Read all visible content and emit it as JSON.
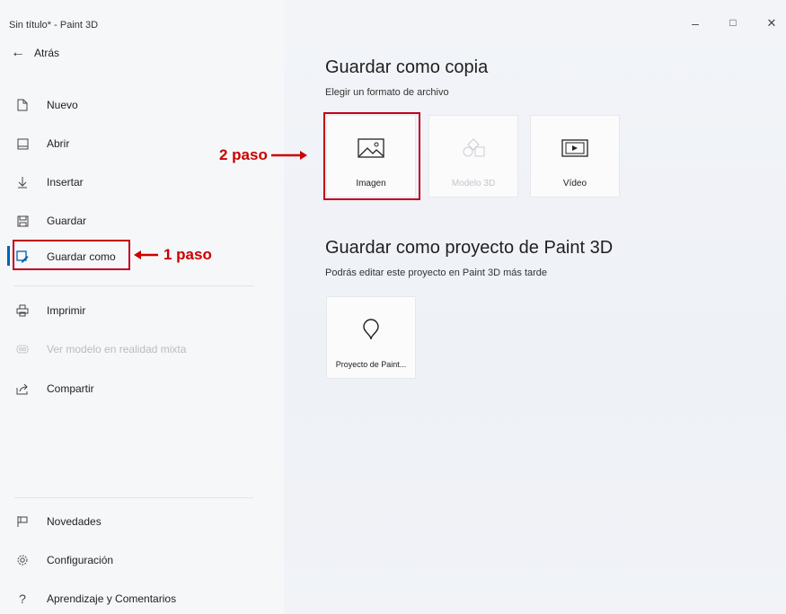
{
  "window": {
    "title": "Sin título* - Paint 3D",
    "minimize": "–",
    "maximize": "□",
    "close": "✕"
  },
  "sidebar": {
    "back_label": "Atrás",
    "items": [
      {
        "label": "Nuevo",
        "icon": "new-file-icon"
      },
      {
        "label": "Abrir",
        "icon": "open-icon"
      },
      {
        "label": "Insertar",
        "icon": "insert-icon"
      },
      {
        "label": "Guardar",
        "icon": "save-icon"
      },
      {
        "label": "Guardar como",
        "icon": "save-as-icon",
        "active": true
      },
      {
        "label": "Imprimir",
        "icon": "print-icon"
      },
      {
        "label": "Ver modelo en realidad mixta",
        "icon": "mixed-reality-icon",
        "disabled": true
      },
      {
        "label": "Compartir",
        "icon": "share-icon"
      }
    ],
    "bottom_items": [
      {
        "label": "Novedades",
        "icon": "flag-icon"
      },
      {
        "label": "Configuración",
        "icon": "gear-icon"
      },
      {
        "label": "Aprendizaje y Comentarios",
        "icon": "help-icon"
      }
    ]
  },
  "main": {
    "copy_section": {
      "title": "Guardar como copia",
      "subtitle": "Elegir un formato de archivo",
      "tiles": [
        {
          "label": "Imagen",
          "icon": "image-icon"
        },
        {
          "label": "Modelo 3D",
          "icon": "model-3d-icon",
          "disabled": true
        },
        {
          "label": "Vídeo",
          "icon": "video-icon"
        }
      ]
    },
    "project_section": {
      "title": "Guardar como proyecto de Paint 3D",
      "subtitle": "Podrás editar este proyecto en Paint 3D más tarde",
      "tiles": [
        {
          "label": "Proyecto de Paint...",
          "icon": "paint-project-icon"
        }
      ]
    }
  },
  "annotations": {
    "step1": "1 paso",
    "step2": "2 paso",
    "color": "#cc0000"
  },
  "colors": {
    "accent": "#0063b1",
    "highlight": "#c0001a"
  }
}
